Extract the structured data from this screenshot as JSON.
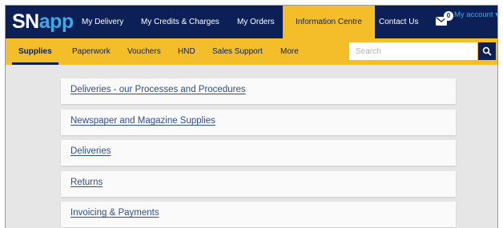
{
  "brand": {
    "logo_sn": "SN",
    "logo_app": "app"
  },
  "top_nav": {
    "items": [
      {
        "label": "My Delivery"
      },
      {
        "label": "My Credits & Charges"
      },
      {
        "label": "My Orders"
      },
      {
        "label": "Information Centre",
        "active": true
      },
      {
        "label": "Contact Us"
      }
    ],
    "mail_badge": "0",
    "account_label": "My account"
  },
  "sub_nav": {
    "items": [
      {
        "label": "Supplies",
        "active": true
      },
      {
        "label": "Paperwork"
      },
      {
        "label": "Vouchers"
      },
      {
        "label": "HND"
      },
      {
        "label": "Sales Support"
      },
      {
        "label": "More"
      }
    ],
    "search_placeholder": "Search"
  },
  "sections": [
    {
      "title": "Deliveries - our Processes and Procedures"
    },
    {
      "title": "Newspaper and Magazine Supplies"
    },
    {
      "title": "Deliveries"
    },
    {
      "title": "Returns"
    },
    {
      "title": "Invoicing & Payments"
    }
  ],
  "colors": {
    "navy": "#0c2057",
    "yellow": "#f4be2b",
    "accent_blue": "#3fa9e6",
    "link": "#2d4f86",
    "panel_bg": "#e6e6e6"
  }
}
